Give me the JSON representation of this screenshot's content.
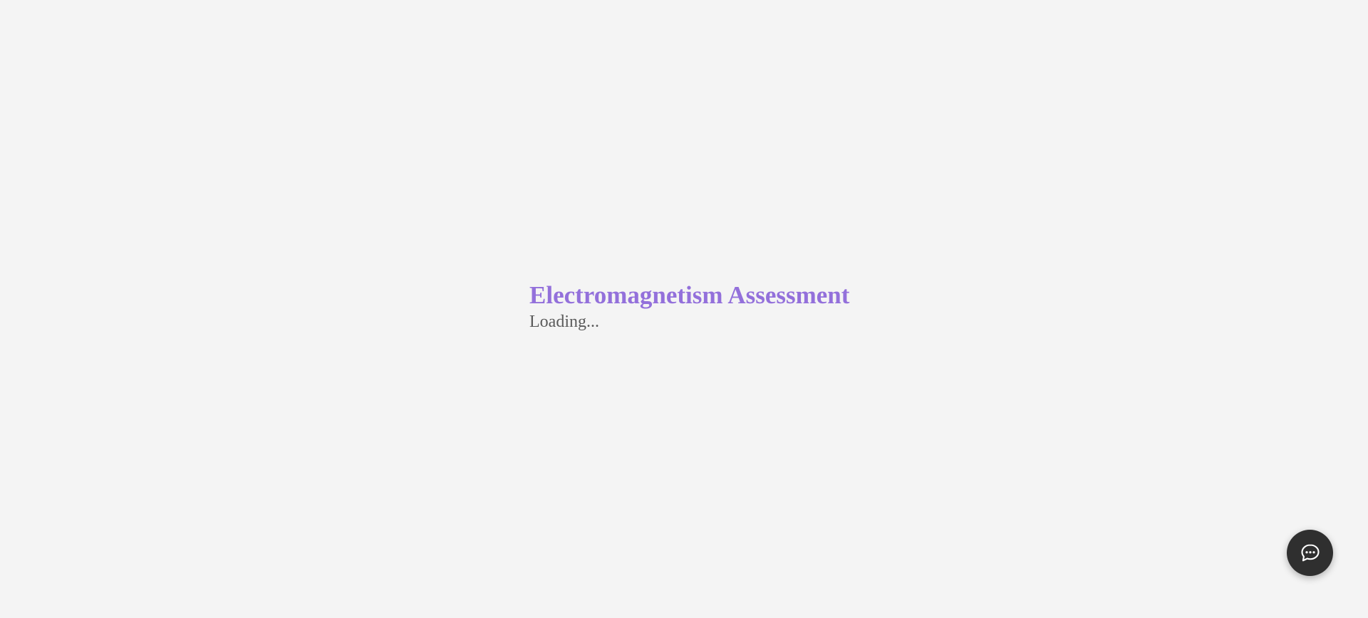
{
  "page": {
    "title": "Electromagnetism Assessment",
    "status_text": "Loading..."
  },
  "chat_widget": {
    "icon": "chat-bubble-icon"
  },
  "colors": {
    "background": "#f4f4f4",
    "title": "#9370db",
    "status_text": "#5a5a5a",
    "chat_button": "#2f2f2f"
  }
}
